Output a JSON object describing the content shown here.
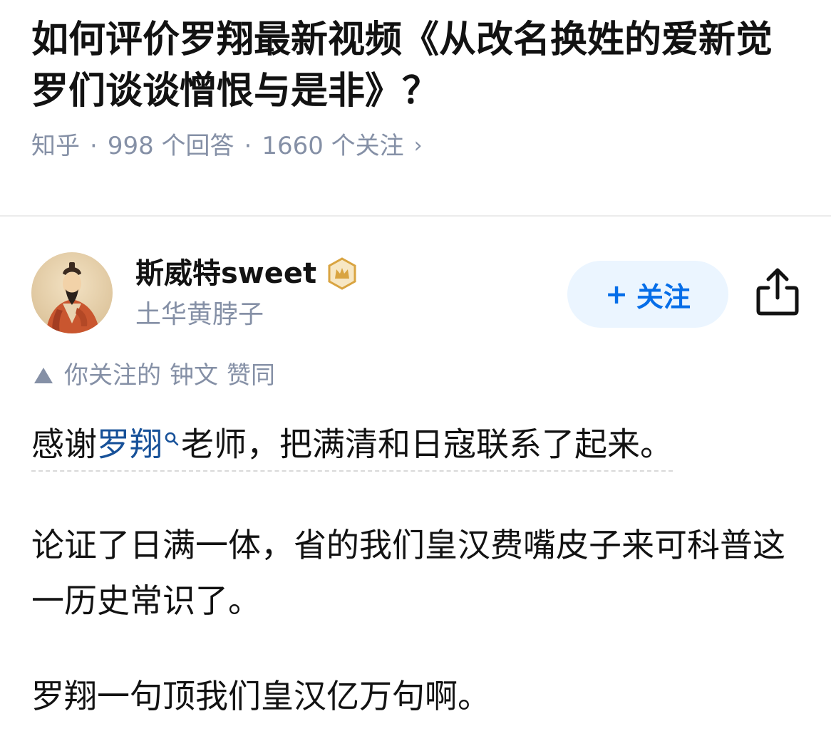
{
  "question": {
    "title": "如何评价罗翔最新视频《从改名换姓的爱新觉罗们谈谈憎恨与是非》？",
    "source": "知乎",
    "separator": "·",
    "answers_count": "998 个回答",
    "followers_count": "1660 个关注",
    "chevron": "›"
  },
  "author": {
    "name": "斯威特sweet",
    "headline": "土华黄脖子",
    "follow_plus": "+",
    "follow_label": "关注",
    "avatar_icon": "portrait-avatar",
    "badge_icon": "crown-badge-icon",
    "share_icon": "share-icon"
  },
  "endorsement": {
    "prefix": "你关注的",
    "name": "钟文",
    "suffix": "赞同"
  },
  "answer": {
    "p1_before": "感谢",
    "p1_link": "罗翔",
    "p1_after": "老师，把满清和日寇联系了起来。",
    "p2": "论证了日满一体，省的我们皇汉费嘴皮子来可科普这一历史常识了。",
    "p3": "罗翔一句顶我们皇汉亿万句啊。"
  },
  "colors": {
    "primary_blue": "#056de8",
    "link_blue": "#175199",
    "meta_gray": "#8590a6",
    "follow_bg": "#ebf5ff",
    "badge_gold": "#d9a441"
  }
}
